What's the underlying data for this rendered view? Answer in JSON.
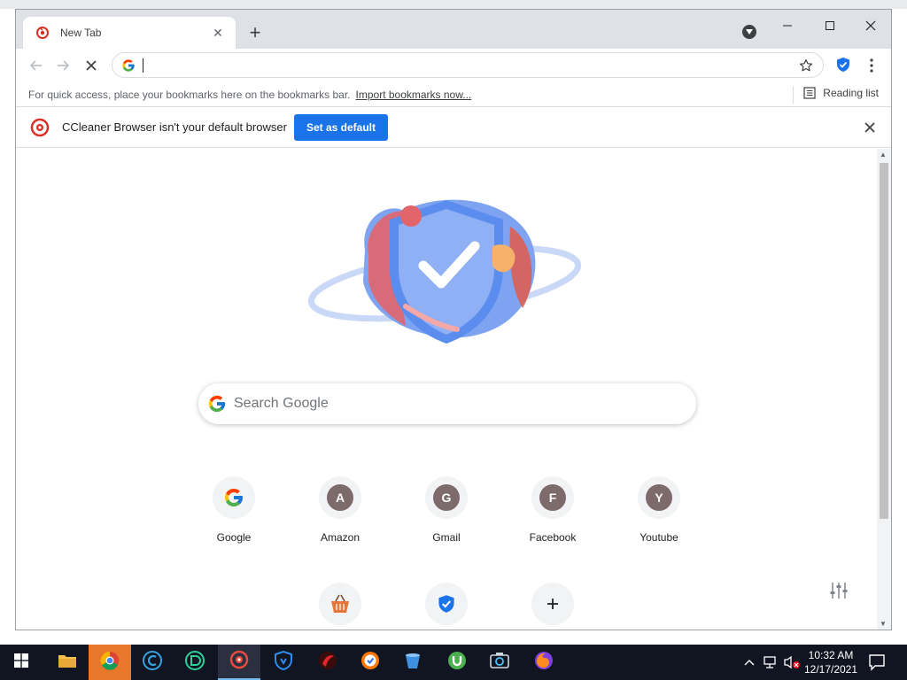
{
  "browser": {
    "tab_title": "New Tab",
    "omnibox_value": "",
    "bookmarks_hint": "For quick access, place your bookmarks here on the bookmarks bar.",
    "import_link": "Import bookmarks now...",
    "reading_list": "Reading list"
  },
  "infobar": {
    "message": "CCleaner Browser isn't your default browser",
    "button": "Set as default"
  },
  "ntp": {
    "search_placeholder": "Search Google",
    "shortcuts": [
      {
        "label": "Google",
        "letter": "G",
        "icon": "google-icon"
      },
      {
        "label": "Amazon",
        "letter": "A",
        "icon": "letter-icon"
      },
      {
        "label": "Gmail",
        "letter": "G",
        "icon": "letter-icon"
      },
      {
        "label": "Facebook",
        "letter": "F",
        "icon": "letter-icon"
      },
      {
        "label": "Youtube",
        "letter": "Y",
        "icon": "letter-icon"
      }
    ],
    "row2": [
      {
        "icon": "basket-icon"
      },
      {
        "icon": "shield-check-icon"
      },
      {
        "icon": "add-shortcut-icon"
      }
    ]
  },
  "taskbar": {
    "time": "10:32 AM",
    "date": "12/17/2021"
  },
  "colors": {
    "accent": "#1a73e8",
    "tile_letter_bg": "#7d6a6b",
    "taskbar_bg": "#101521"
  }
}
